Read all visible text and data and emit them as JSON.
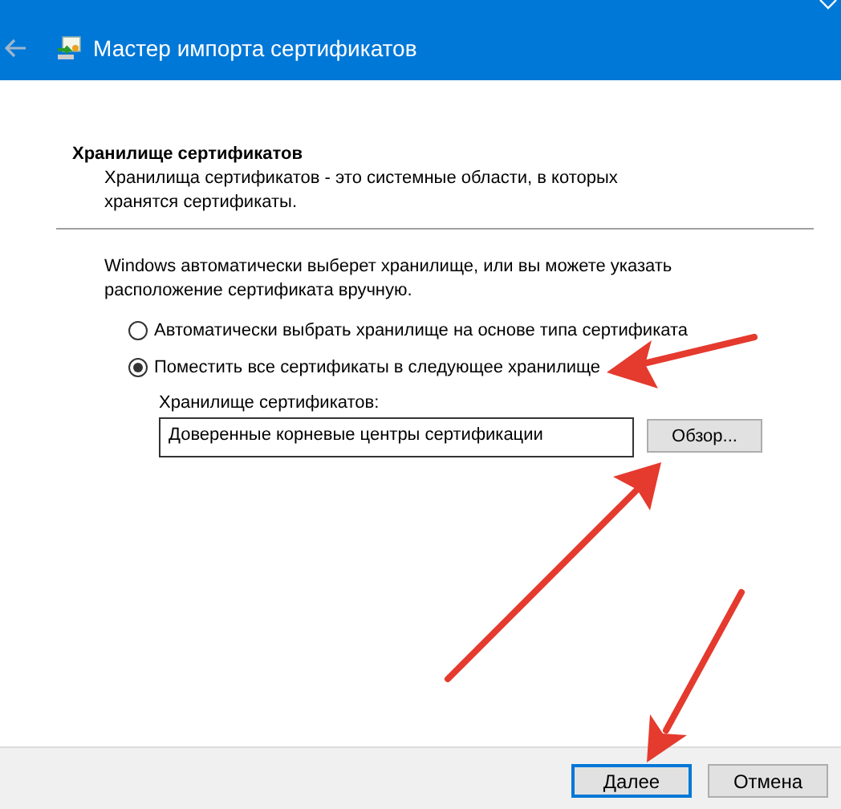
{
  "window": {
    "title": "Мастер импорта сертификатов"
  },
  "header": {
    "title": "Хранилище сертификатов",
    "description": "Хранилища сертификатов - это системные области, в которых хранятся сертификаты."
  },
  "intro": "Windows автоматически выберет хранилище, или вы можете указать расположение сертификата вручную.",
  "options": [
    {
      "label": "Автоматически выбрать хранилище на основе типа сертификата",
      "selected": false
    },
    {
      "label": "Поместить все сертификаты в следующее хранилище",
      "selected": true
    }
  ],
  "store": {
    "label": "Хранилище сертификатов:",
    "value": "Доверенные корневые центры сертификации",
    "browse_button": "Обзор..."
  },
  "buttons": [
    {
      "label": "Далее",
      "default": true
    },
    {
      "label": "Отмена",
      "default": false
    }
  ]
}
